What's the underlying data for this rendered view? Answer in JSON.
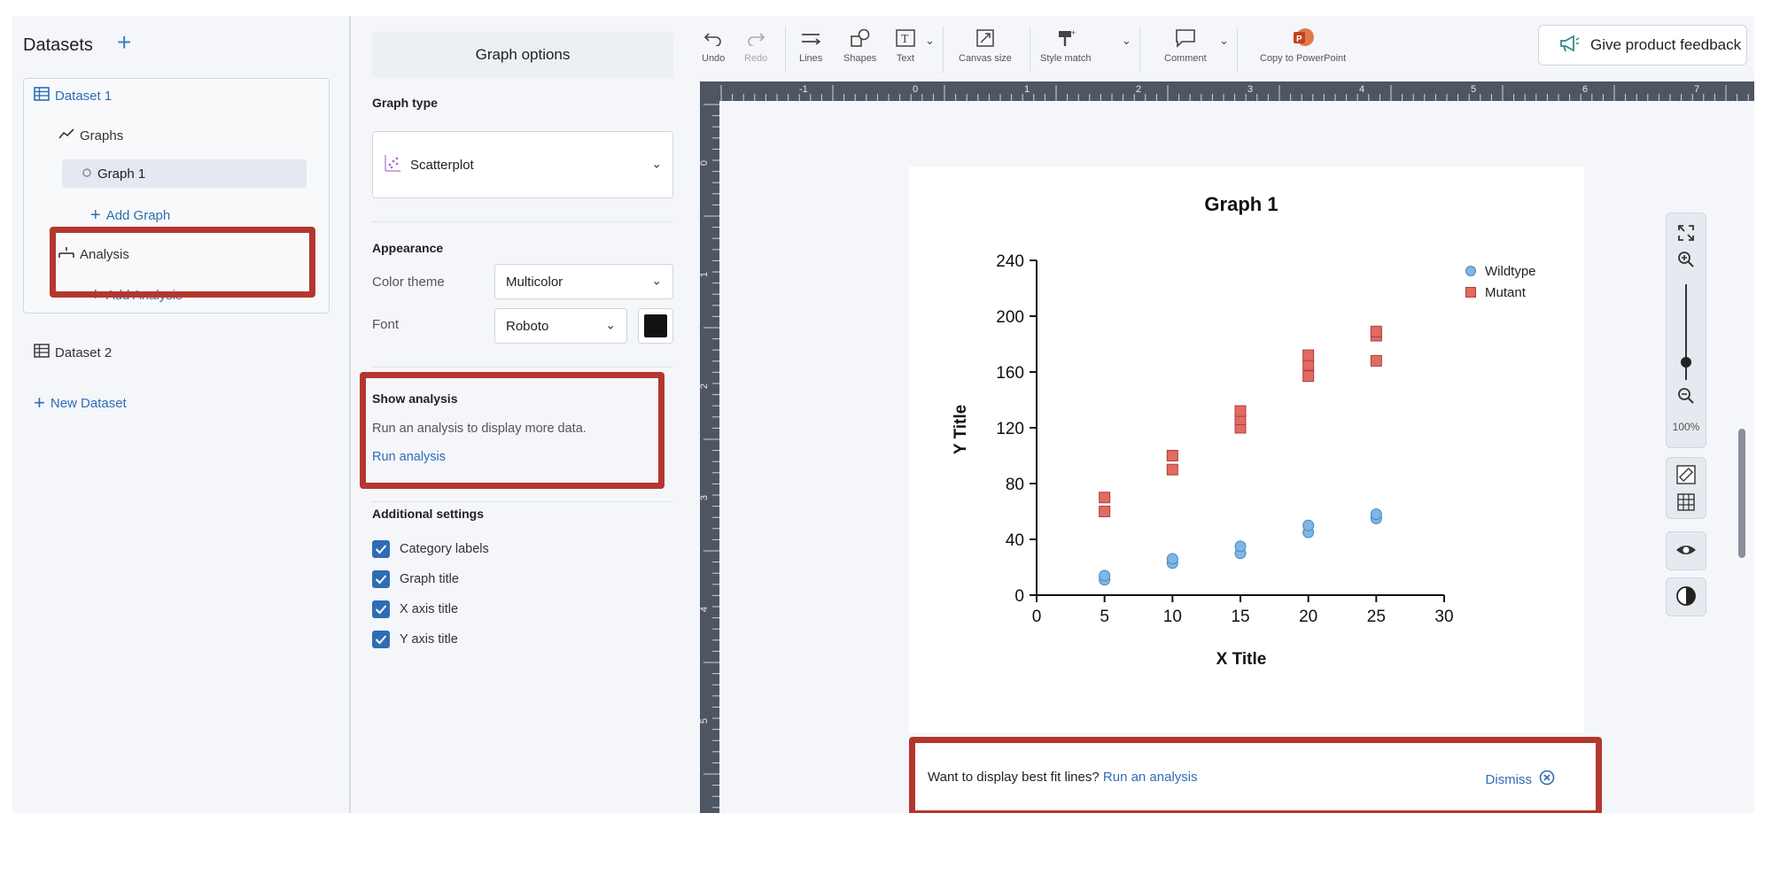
{
  "sidebar": {
    "title": "Datasets",
    "items": {
      "dataset1": "Dataset 1",
      "graphs": "Graphs",
      "graph1": "Graph 1",
      "add_graph": "Add Graph",
      "analysis": "Analysis",
      "add_analysis": "Add Analysis",
      "dataset2": "Dataset 2",
      "new_dataset": "New Dataset"
    }
  },
  "options": {
    "header": "Graph options",
    "graph_type_label": "Graph type",
    "graph_type_value": "Scatterplot",
    "appearance_label": "Appearance",
    "color_theme_label": "Color theme",
    "color_theme_value": "Multicolor",
    "font_label": "Font",
    "font_value": "Roboto",
    "font_color": "#111111",
    "show_analysis_label": "Show analysis",
    "show_analysis_text": "Run an analysis to display more data.",
    "run_analysis_link": "Run analysis",
    "additional_label": "Additional settings",
    "checkboxes": [
      {
        "label": "Category labels",
        "checked": true
      },
      {
        "label": "Graph title",
        "checked": true
      },
      {
        "label": "X axis title",
        "checked": true
      },
      {
        "label": "Y axis title",
        "checked": true
      }
    ]
  },
  "toolbar": {
    "undo": "Undo",
    "redo": "Redo",
    "lines": "Lines",
    "shapes": "Shapes",
    "text": "Text",
    "canvas_size": "Canvas size",
    "style_match": "Style match",
    "comment": "Comment",
    "copy_ppt": "Copy to PowerPoint",
    "feedback": "Give product feedback"
  },
  "ruler": {
    "top": [
      "-1",
      "0",
      "1",
      "2",
      "3",
      "4",
      "5",
      "6",
      "7"
    ],
    "left": [
      "0",
      "1",
      "2",
      "3",
      "4",
      "5"
    ]
  },
  "zoom": {
    "level": "100%",
    "level_fraction": 0.5
  },
  "banner": {
    "text": "Want to display best fit lines?",
    "link": "Run an analysis",
    "dismiss": "Dismiss"
  },
  "colors": {
    "accent": "#2f6db3",
    "highlight": "#b3372f",
    "wildtype": "#7eb6e6",
    "mutant": "#e26a62"
  },
  "chart_data": {
    "type": "scatter",
    "title": "Graph 1",
    "xlabel": "X Title",
    "ylabel": "Y Title",
    "xlim": [
      0,
      30
    ],
    "ylim": [
      0,
      240
    ],
    "xticks": [
      0,
      5,
      10,
      15,
      20,
      25,
      30
    ],
    "yticks": [
      0,
      40,
      80,
      120,
      160,
      200,
      240
    ],
    "legend_position": "top-right",
    "series": [
      {
        "name": "Wildtype",
        "marker": "circle",
        "color": "#7eb6e6",
        "points": [
          [
            5,
            11
          ],
          [
            5,
            14
          ],
          [
            10,
            23
          ],
          [
            10,
            26
          ],
          [
            15,
            30
          ],
          [
            15,
            35
          ],
          [
            20,
            45
          ],
          [
            20,
            50
          ],
          [
            25,
            55
          ],
          [
            25,
            58
          ]
        ]
      },
      {
        "name": "Mutant",
        "marker": "square",
        "color": "#e26a62",
        "points": [
          [
            5,
            60
          ],
          [
            5,
            70
          ],
          [
            10,
            90
          ],
          [
            10,
            100
          ],
          [
            15,
            120
          ],
          [
            15,
            126
          ],
          [
            15,
            132
          ],
          [
            20,
            157
          ],
          [
            20,
            165
          ],
          [
            20,
            172
          ],
          [
            25,
            168
          ],
          [
            25,
            186
          ],
          [
            25,
            189
          ]
        ]
      }
    ]
  }
}
